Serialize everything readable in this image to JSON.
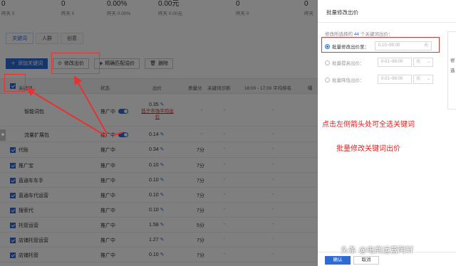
{
  "stats": [
    {
      "value": "0",
      "sub": "昨天 0"
    },
    {
      "value": "0",
      "sub": "昨天 0"
    },
    {
      "value": "0.00%",
      "sub": "昨天 0.00%"
    },
    {
      "value": "0.00元",
      "sub": "昨天 0.00元"
    },
    {
      "value": "0",
      "sub": "昨天 0"
    },
    {
      "value": "0",
      "sub": "昨天"
    }
  ],
  "tabs": [
    "关键词",
    "人群",
    "创意"
  ],
  "toolbar": {
    "add": "添加关键词",
    "modify": "修改出价",
    "match": "精确匹配溢价",
    "delete": "删除"
  },
  "columns": {
    "keyword": "关键词",
    "status": "状态",
    "bid": "出价",
    "quality": "质量分",
    "diagnosis": "关键词诊断",
    "rank": "16:00 - 17:00 平均排名",
    "more": "曝"
  },
  "rows": [
    {
      "keyword": "智能词包",
      "status": "推广中",
      "bid": "0.35",
      "quality": "-",
      "diagnosis": "-",
      "rank": "-",
      "note": "低于市场平均出价",
      "toggle": true,
      "checkbox": false
    },
    {
      "keyword": "流量扩展包",
      "status": "推广中",
      "bid": "0.14",
      "quality": "-",
      "diagnosis": "-",
      "rank": "-",
      "toggle": true,
      "checkbox": false
    },
    {
      "keyword": "代账",
      "status": "推广中",
      "bid": "0.34",
      "quality": "7分",
      "diagnosis": "-",
      "rank": "-",
      "checkbox": true
    },
    {
      "keyword": "推广宝",
      "status": "推广中",
      "bid": "0.10",
      "quality": "7分",
      "diagnosis": "-",
      "rank": "-",
      "checkbox": true
    },
    {
      "keyword": "直通车车手",
      "status": "推广中",
      "bid": "0.10",
      "quality": "7分",
      "diagnosis": "-",
      "rank": "-",
      "checkbox": true
    },
    {
      "keyword": "直通车代运营",
      "status": "推广中",
      "bid": "0.10",
      "quality": "7分",
      "diagnosis": "-",
      "rank": "-",
      "checkbox": true
    },
    {
      "keyword": "搜索代",
      "status": "推广中",
      "bid": "0.10",
      "quality": "7分",
      "diagnosis": "-",
      "rank": "-",
      "checkbox": true
    },
    {
      "keyword": "托管运营",
      "status": "推广中",
      "bid": "1.58",
      "quality": "5分",
      "diagnosis": "-",
      "rank": "-",
      "checkbox": true
    },
    {
      "keyword": "店铺托管运营",
      "status": "推广中",
      "bid": "1.27",
      "quality": "7分",
      "diagnosis": "-",
      "rank": "-",
      "checkbox": true
    },
    {
      "keyword": "店铺托管",
      "status": "推广中",
      "bid": "0.10",
      "quality": "7分",
      "diagnosis": "-",
      "rank": "-",
      "checkbox": true
    }
  ],
  "drawer": {
    "title": "批量修改出价",
    "desc_prefix": "修改所选择的",
    "count": "44",
    "desc_suffix": "个关键词出价：",
    "options": [
      {
        "label": "批量修改出价至：",
        "placeholder": "0.10~99.00",
        "unit": "元",
        "selected": true
      },
      {
        "label": "批量提高出价：",
        "placeholder": "0.01~99.00",
        "unit": "元",
        "selected": false
      },
      {
        "label": "批量降低出价：",
        "placeholder": "0.01~99.00",
        "unit": "元",
        "selected": false
      }
    ],
    "confirm": "确认",
    "cancel": "取消"
  },
  "side_panel": [
    "修",
    "选"
  ],
  "annotations": {
    "note1": "点击左侧箭头处可全选关键词",
    "note2": "批量修改关键词出价"
  },
  "watermark": "头条 @电商运营阿轩",
  "expander": "»",
  "colors": {
    "accent": "#2d6bd6",
    "annotation": "#e53232",
    "overlay": "rgba(0,0,0,0.5)"
  }
}
